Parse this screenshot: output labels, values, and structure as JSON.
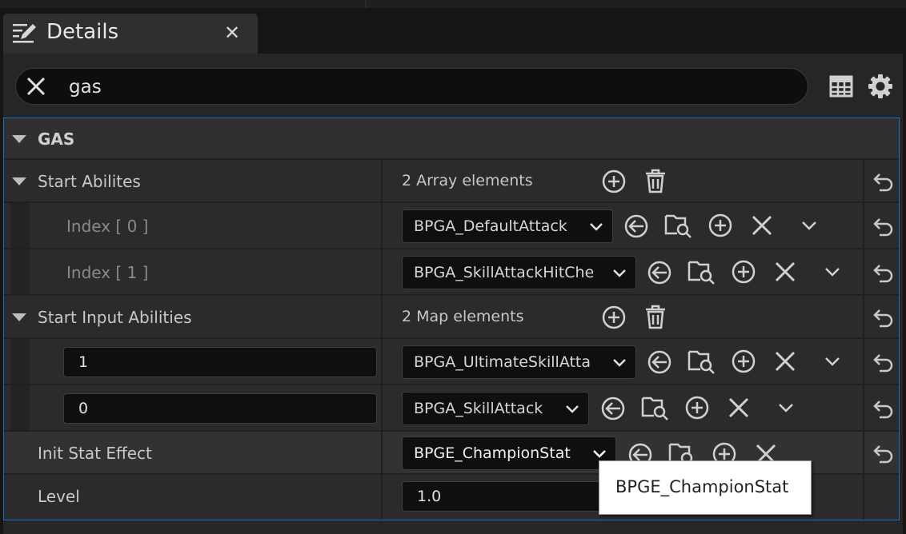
{
  "tab": {
    "title": "Details",
    "close_label": "✕"
  },
  "search": {
    "value": "gas",
    "placeholder": ""
  },
  "category": {
    "label": "GAS"
  },
  "start_abilities": {
    "label": "Start Abilites",
    "count": "2 Array elements",
    "items": [
      {
        "index_label": "Index [ 0 ]",
        "value": "BPGA_DefaultAttack"
      },
      {
        "index_label": "Index [ 1 ]",
        "value": "BPGA_SkillAttackHitChe"
      }
    ]
  },
  "start_input_abilities": {
    "label": "Start Input Abilities",
    "count": "2 Map elements",
    "items": [
      {
        "key": "1",
        "value": "BPGA_UltimateSkillAtta"
      },
      {
        "key": "0",
        "value": "BPGA_SkillAttack"
      }
    ]
  },
  "init_stat_effect": {
    "label": "Init Stat Effect",
    "value": "BPGE_ChampionStat"
  },
  "level": {
    "label": "Level",
    "value": "1.0"
  },
  "tooltip": {
    "text": "BPGE_ChampionStat"
  },
  "colors": {
    "accent_border": "#1a6fc7",
    "panel": "#262626",
    "row": "#2b2b2b"
  }
}
